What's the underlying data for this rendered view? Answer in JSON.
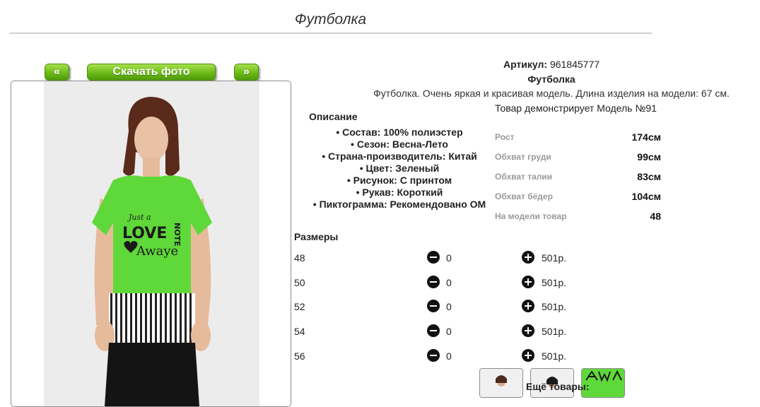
{
  "product": {
    "title": "Футболка",
    "article_label": "Артикул:",
    "article_value": "961845777",
    "name": "Футболка",
    "description": "Футболка. Очень яркая и красивая модель. Длина изделия на модели: 67 см."
  },
  "nav": {
    "prev_label": "«",
    "download_label": "Скачать фото",
    "next_label": "»"
  },
  "specs": {
    "heading": "Описание",
    "items": [
      "Состав: 100% полиэстер",
      "Сезон: Весна-Лето",
      "Страна-производитель: Китай",
      "Цвет: Зеленый",
      "Рисунок: С принтом",
      "Рукав: Короткий",
      "Пиктограмма: Рекомендовано ОМ"
    ]
  },
  "model": {
    "intro": "Товар демонстрирует Модель №91",
    "rows": [
      {
        "label": "Рост",
        "value": "174см"
      },
      {
        "label": "Обхват груди",
        "value": "99см"
      },
      {
        "label": "Обхват талии",
        "value": "83см"
      },
      {
        "label": "Обхват бёдер",
        "value": "104см"
      },
      {
        "label": "На модели товар",
        "value": "48"
      }
    ]
  },
  "sizes": {
    "heading": "Размеры",
    "rows": [
      {
        "size": "48",
        "qty": "0",
        "price": "501р."
      },
      {
        "size": "50",
        "qty": "0",
        "price": "501р."
      },
      {
        "size": "52",
        "qty": "0",
        "price": "501р."
      },
      {
        "size": "54",
        "qty": "0",
        "price": "501р."
      },
      {
        "size": "56",
        "qty": "0",
        "price": "501р."
      }
    ]
  },
  "more": {
    "heading": "Ещё товары:"
  },
  "photo": {
    "print_line1": "Just a",
    "print_line2": "LOVE",
    "print_line3": "NOTE",
    "print_line4": "Awaye"
  },
  "colors": {
    "accent_green": "#6cbb18",
    "shirt_green": "#5fd83a"
  }
}
